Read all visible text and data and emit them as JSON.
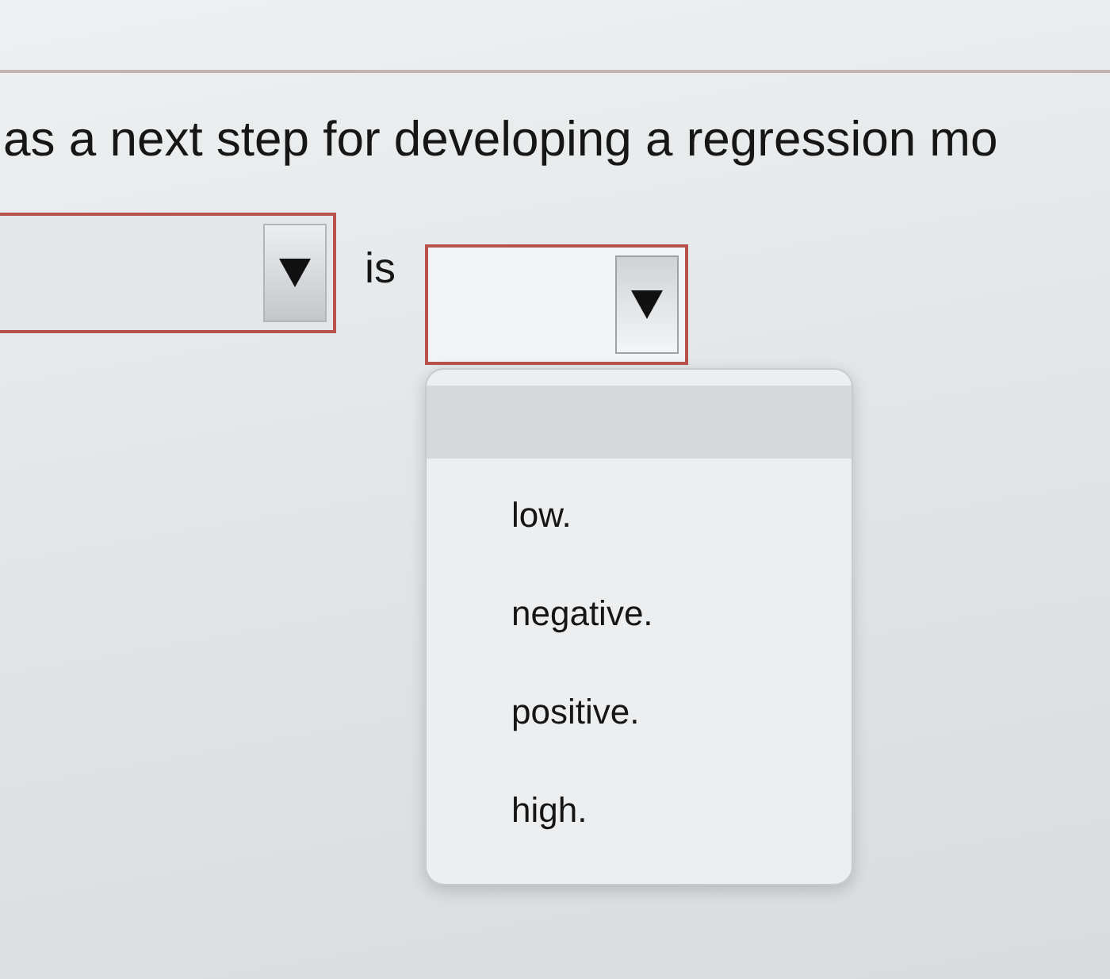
{
  "question": {
    "text": "as a next step for developing a regression mo"
  },
  "answer_row": [
    {
      "kind": "dropdown",
      "expanded": false
    },
    {
      "kind": "text",
      "text": "is"
    },
    {
      "kind": "dropdown",
      "expanded": true,
      "menu": {
        "blank_option_highlighted": true,
        "options": [
          {
            "label": "low.",
            "selected": false
          },
          {
            "label": "negative.",
            "selected": false
          },
          {
            "label": "positive.",
            "selected": false
          },
          {
            "label": "high.",
            "selected": false
          }
        ]
      }
    }
  ]
}
